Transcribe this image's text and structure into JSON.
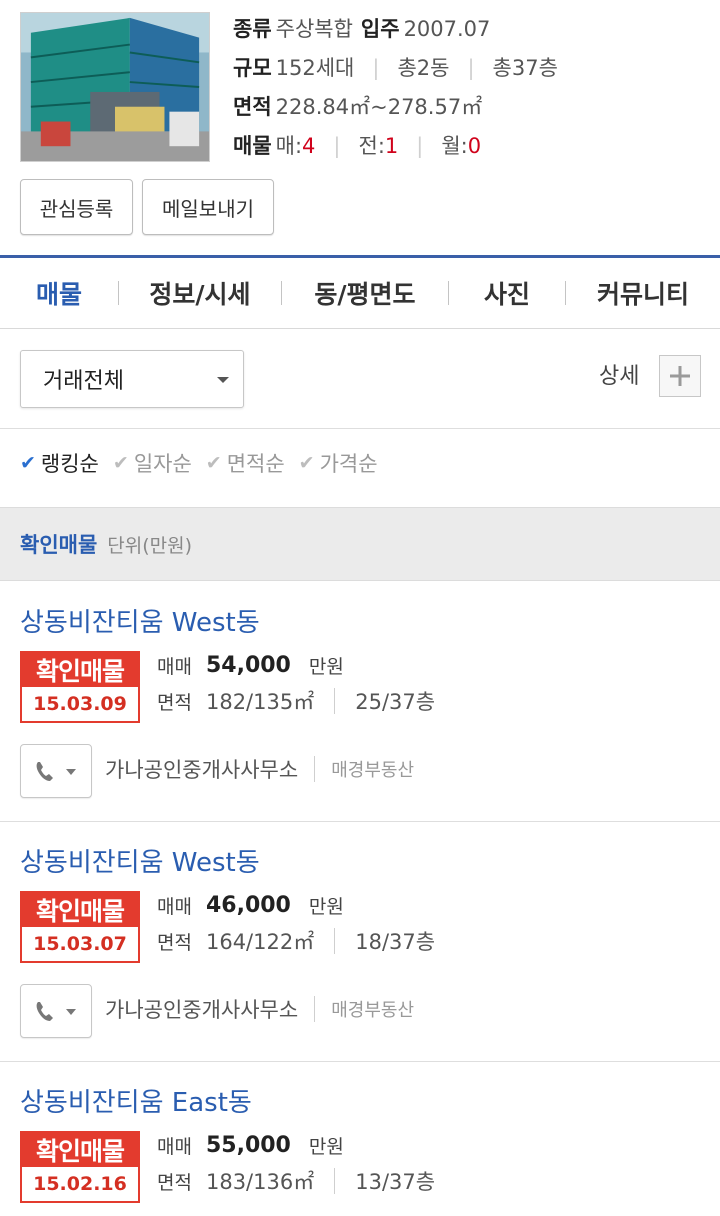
{
  "complex": {
    "type_label": "종류",
    "type_value": "주상복합",
    "movein_label": "입주",
    "movein_value": "2007.07",
    "scale_label": "규모",
    "households": "152세대",
    "buildings": "총2동",
    "floors": "총37층",
    "area_label": "면적",
    "area_value": "228.84㎡~278.57㎡",
    "listings_label": "매물",
    "sale_label": "매:",
    "sale_count": "4",
    "jeonse_label": "전:",
    "jeonse_count": "1",
    "monthly_label": "월:",
    "monthly_count": "0"
  },
  "actions": {
    "favorite": "관심등록",
    "email": "메일보내기"
  },
  "tabs": [
    {
      "label": "매물",
      "active": true
    },
    {
      "label": "정보/시세",
      "active": false
    },
    {
      "label": "동/평면도",
      "active": false
    },
    {
      "label": "사진",
      "active": false
    },
    {
      "label": "커뮤니티",
      "active": false
    }
  ],
  "filter": {
    "deal_type": "거래전체",
    "detail_label": "상세"
  },
  "sorts": [
    {
      "label": "랭킹순",
      "active": true
    },
    {
      "label": "일자순",
      "active": false
    },
    {
      "label": "면적순",
      "active": false
    },
    {
      "label": "가격순",
      "active": false
    }
  ],
  "section": {
    "title": "확인매물",
    "unit": "단위(만원)"
  },
  "listing_labels": {
    "stamp": "확인매물",
    "deal": "매매",
    "currency": "만원",
    "area": "면적"
  },
  "listings": [
    {
      "name": "상동비잔티움 West동",
      "date": "15.03.09",
      "price": "54,000",
      "area": "182/135㎡",
      "floor": "25/37층",
      "agency": "가나공인중개사사무소",
      "source": "매경부동산"
    },
    {
      "name": "상동비잔티움 West동",
      "date": "15.03.07",
      "price": "46,000",
      "area": "164/122㎡",
      "floor": "18/37층",
      "agency": "가나공인중개사사무소",
      "source": "매경부동산"
    },
    {
      "name": "상동비잔티움 East동",
      "date": "15.02.16",
      "price": "55,000",
      "area": "183/136㎡",
      "floor": "13/37층"
    }
  ],
  "colors": {
    "accent": "#2a5db0",
    "stamp_red": "#e33b2e",
    "count_red": "#d0021b"
  }
}
